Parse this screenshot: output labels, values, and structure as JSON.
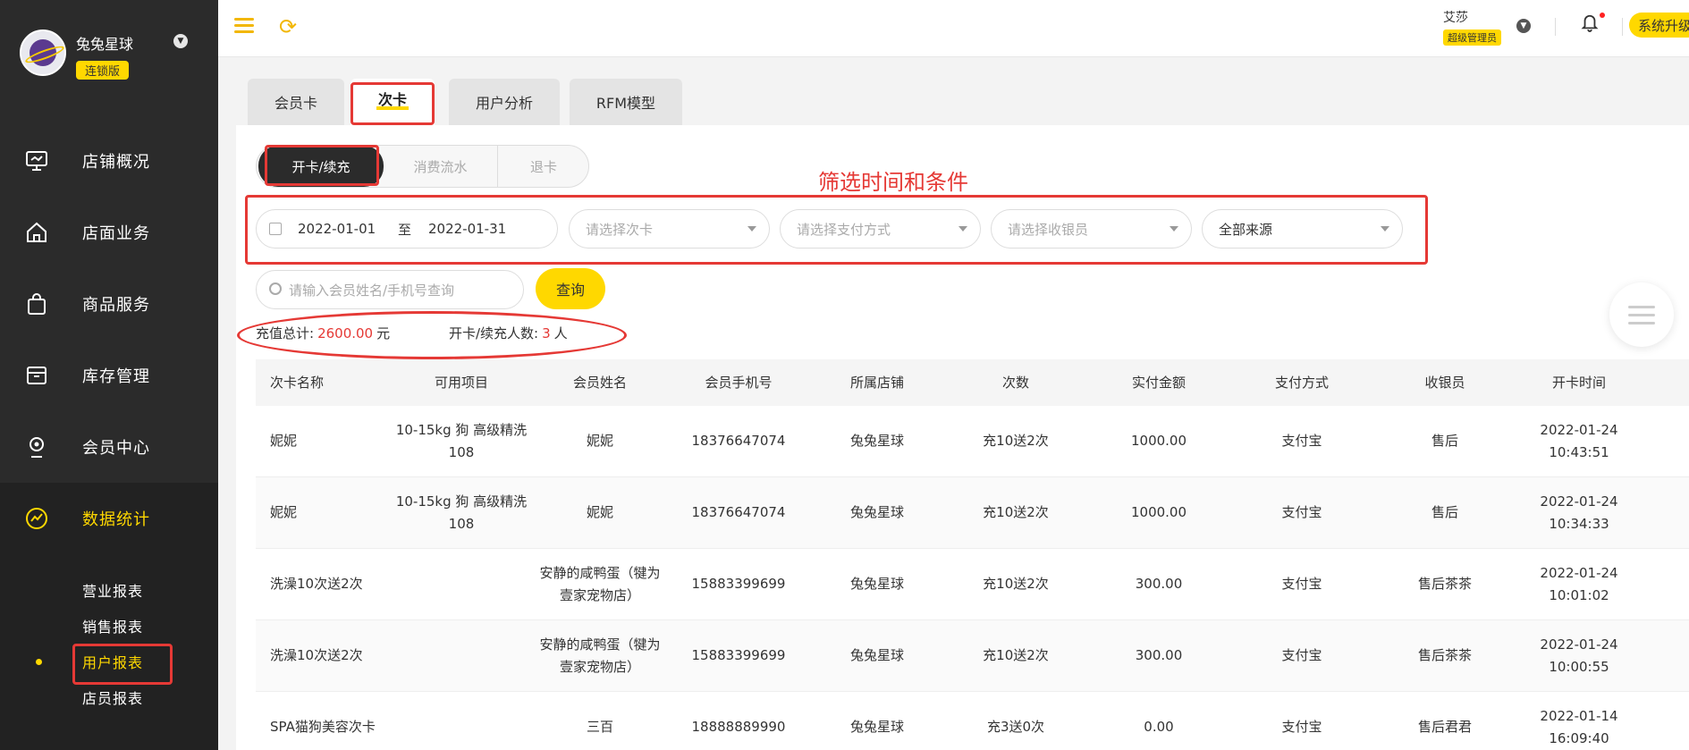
{
  "sidebar": {
    "brand_name": "兔兔星球",
    "brand_tag": "连锁版",
    "items": [
      {
        "label": "店铺概况"
      },
      {
        "label": "店面业务"
      },
      {
        "label": "商品服务"
      },
      {
        "label": "库存管理"
      },
      {
        "label": "会员中心"
      },
      {
        "label": "数据统计"
      }
    ],
    "sub_items": [
      {
        "label": "营业报表"
      },
      {
        "label": "销售报表"
      },
      {
        "label": "用户报表"
      },
      {
        "label": "店员报表"
      }
    ]
  },
  "header": {
    "user_name": "艾莎",
    "user_role": "超级管理员",
    "upgrade": "系统升级"
  },
  "tabs": [
    {
      "label": "会员卡"
    },
    {
      "label": "次卡"
    },
    {
      "label": "用户分析"
    },
    {
      "label": "RFM模型"
    }
  ],
  "segments": [
    {
      "label": "开卡/续充"
    },
    {
      "label": "消费流水"
    },
    {
      "label": "退卡"
    }
  ],
  "annotation": "筛选时间和条件",
  "filters": {
    "date_start": "2022-01-01",
    "date_sep": "至",
    "date_end": "2022-01-31",
    "card_placeholder": "请选择次卡",
    "pay_placeholder": "请选择支付方式",
    "cashier_placeholder": "请选择收银员",
    "source_value": "全部来源",
    "search_placeholder": "请输入会员姓名/手机号查询",
    "query_label": "查询"
  },
  "stats": {
    "total_label": "充值总计:",
    "total_value": "2600.00",
    "total_unit": "元",
    "count_label": "开卡/续充人数:",
    "count_value": "3",
    "count_unit": "人"
  },
  "table": {
    "columns": [
      "次卡名称",
      "可用项目",
      "会员姓名",
      "会员手机号",
      "所属店铺",
      "次数",
      "实付金额",
      "支付方式",
      "收银员",
      "开卡时间"
    ],
    "rows": [
      {
        "name": "妮妮",
        "project": "10-15kg 狗 高级精洗 108",
        "member": "妮妮",
        "phone": "18376647074",
        "store": "兔兔星球",
        "times": "充10送2次",
        "amount": "1000.00",
        "pay": "支付宝",
        "cashier": "售后",
        "time": "2022-01-24 10:43:51"
      },
      {
        "name": "妮妮",
        "project": "10-15kg 狗 高级精洗 108",
        "member": "妮妮",
        "phone": "18376647074",
        "store": "兔兔星球",
        "times": "充10送2次",
        "amount": "1000.00",
        "pay": "支付宝",
        "cashier": "售后",
        "time": "2022-01-24 10:34:33"
      },
      {
        "name": "洗澡10次送2次",
        "project": "",
        "member": "安静的咸鸭蛋（犍为壹家宠物店）",
        "phone": "15883399699",
        "store": "兔兔星球",
        "times": "充10送2次",
        "amount": "300.00",
        "pay": "支付宝",
        "cashier": "售后茶茶",
        "time": "2022-01-24 10:01:02"
      },
      {
        "name": "洗澡10次送2次",
        "project": "",
        "member": "安静的咸鸭蛋（犍为壹家宠物店）",
        "phone": "15883399699",
        "store": "兔兔星球",
        "times": "充10送2次",
        "amount": "300.00",
        "pay": "支付宝",
        "cashier": "售后茶茶",
        "time": "2022-01-24 10:00:55"
      },
      {
        "name": "SPA猫狗美容次卡",
        "project": "",
        "member": "三百",
        "phone": "18888889990",
        "store": "兔兔星球",
        "times": "充3送0次",
        "amount": "0.00",
        "pay": "支付宝",
        "cashier": "售后君君",
        "time": "2022-01-14 16:09:40"
      }
    ]
  }
}
